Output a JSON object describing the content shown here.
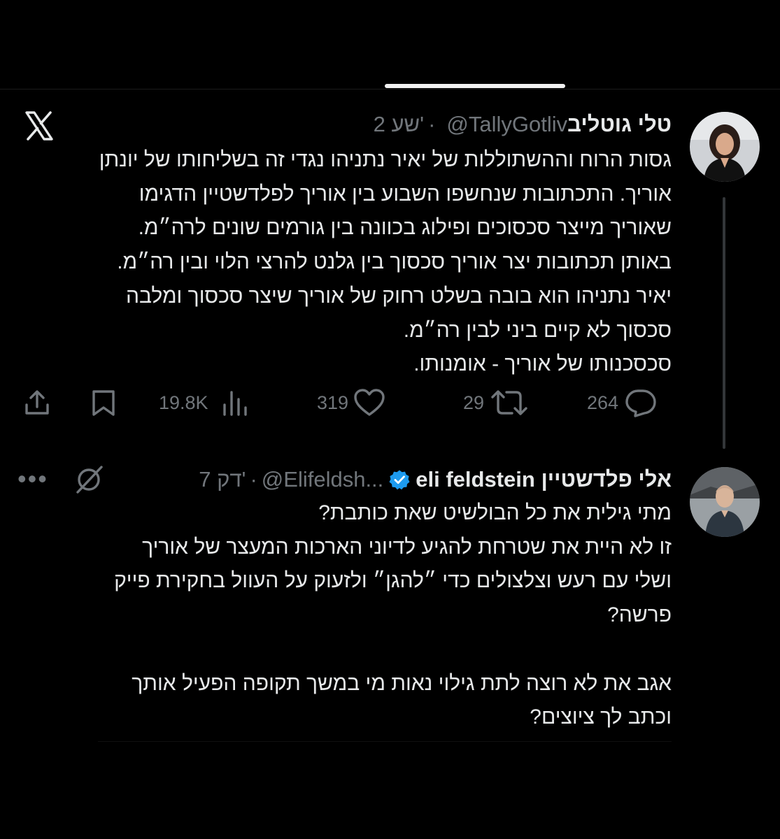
{
  "colors": {
    "background": "#000000",
    "text_primary": "#e7e9ea",
    "text_secondary": "#71767b",
    "verified_badge": "#1d9bf0",
    "thread_line": "#333639"
  },
  "app_icon": "x-logo-icon",
  "tweets": [
    {
      "author_name": "טלי גוטליב",
      "handle": "@TallyGotliv",
      "separator": "·",
      "time": "2 שע'",
      "body_lines": [
        "גסות הרוח וההשתוללות של יאיר נתניהו נגדי זה בשליחותו של יונתן",
        "אוריך. התכתובות שנחשפו השבוע בין אוריך לפלדשטיין הדגימו",
        "שאוריך מייצר סכסוכים ופילוג בכוונה בין גורמים שונים לרה״מ.",
        "באותן תכתובות יצר אוריך סכסוך בין גלנט להרצי הלוי ובין רה״מ.",
        "יאיר נתניהו הוא בובה בשלט רחוק של אוריך שיצר סכסוך ומלבה",
        "סכסוך לא קיים ביני לבין רה״מ.",
        "סכסכנותו של אוריך - אומנותו."
      ],
      "actions": {
        "replies": "264",
        "reposts": "29",
        "likes": "319",
        "views": "19.8K"
      }
    },
    {
      "author_name": "eli feldstein אלי פלדשטיין",
      "verified": true,
      "handle": "@Elifeldsh...",
      "separator": "·",
      "time": "7 דק'",
      "body_lines": [
        "מתי גילית את כל הבולשיט שאת כותבת?",
        "זו לא היית את שטרחת להגיע לדיוני הארכות המעצר של אוריך",
        "ושלי עם רעש וצלצולים כדי ״להגן״ ולזעוק על העוול בחקירת פייק",
        "פרשה?",
        "",
        "אגב את לא רוצה לתת גילוי נאות מי במשך תקופה הפעיל אותך",
        "וכתב לך ציוצים?"
      ]
    }
  ]
}
